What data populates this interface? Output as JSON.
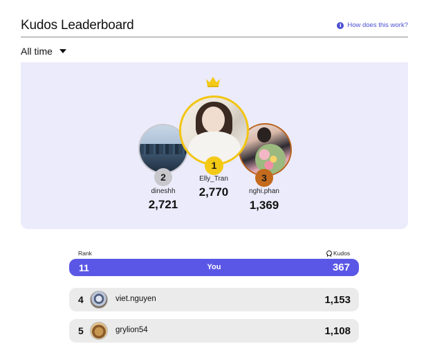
{
  "header": {
    "title": "Kudos Leaderboard",
    "help_link": "How does this work?"
  },
  "filter": {
    "selected": "All time"
  },
  "podium": [
    {
      "rank": "2",
      "username": "dineshh",
      "kudos": "2,721"
    },
    {
      "rank": "1",
      "username": "Elly_Tran",
      "kudos": "2,770"
    },
    {
      "rank": "3",
      "username": "nghi.phan",
      "kudos": "1,369"
    }
  ],
  "table": {
    "rank_header": "Rank",
    "kudos_header": "Kudos",
    "you": {
      "rank": "11",
      "label": "You",
      "kudos": "367"
    },
    "rows": [
      {
        "rank": "4",
        "username": "viet.nguyen",
        "kudos": "1,153"
      },
      {
        "rank": "5",
        "username": "grylion54",
        "kudos": "1,108"
      }
    ]
  },
  "colors": {
    "accent": "#5b57e6",
    "gold": "#f4c915",
    "silver": "#c7c7cc",
    "bronze": "#c46a1d",
    "podium_bg": "#ecebfb"
  },
  "icons": [
    "info-icon",
    "caret-down-icon",
    "crown-icon",
    "medal-icon"
  ]
}
